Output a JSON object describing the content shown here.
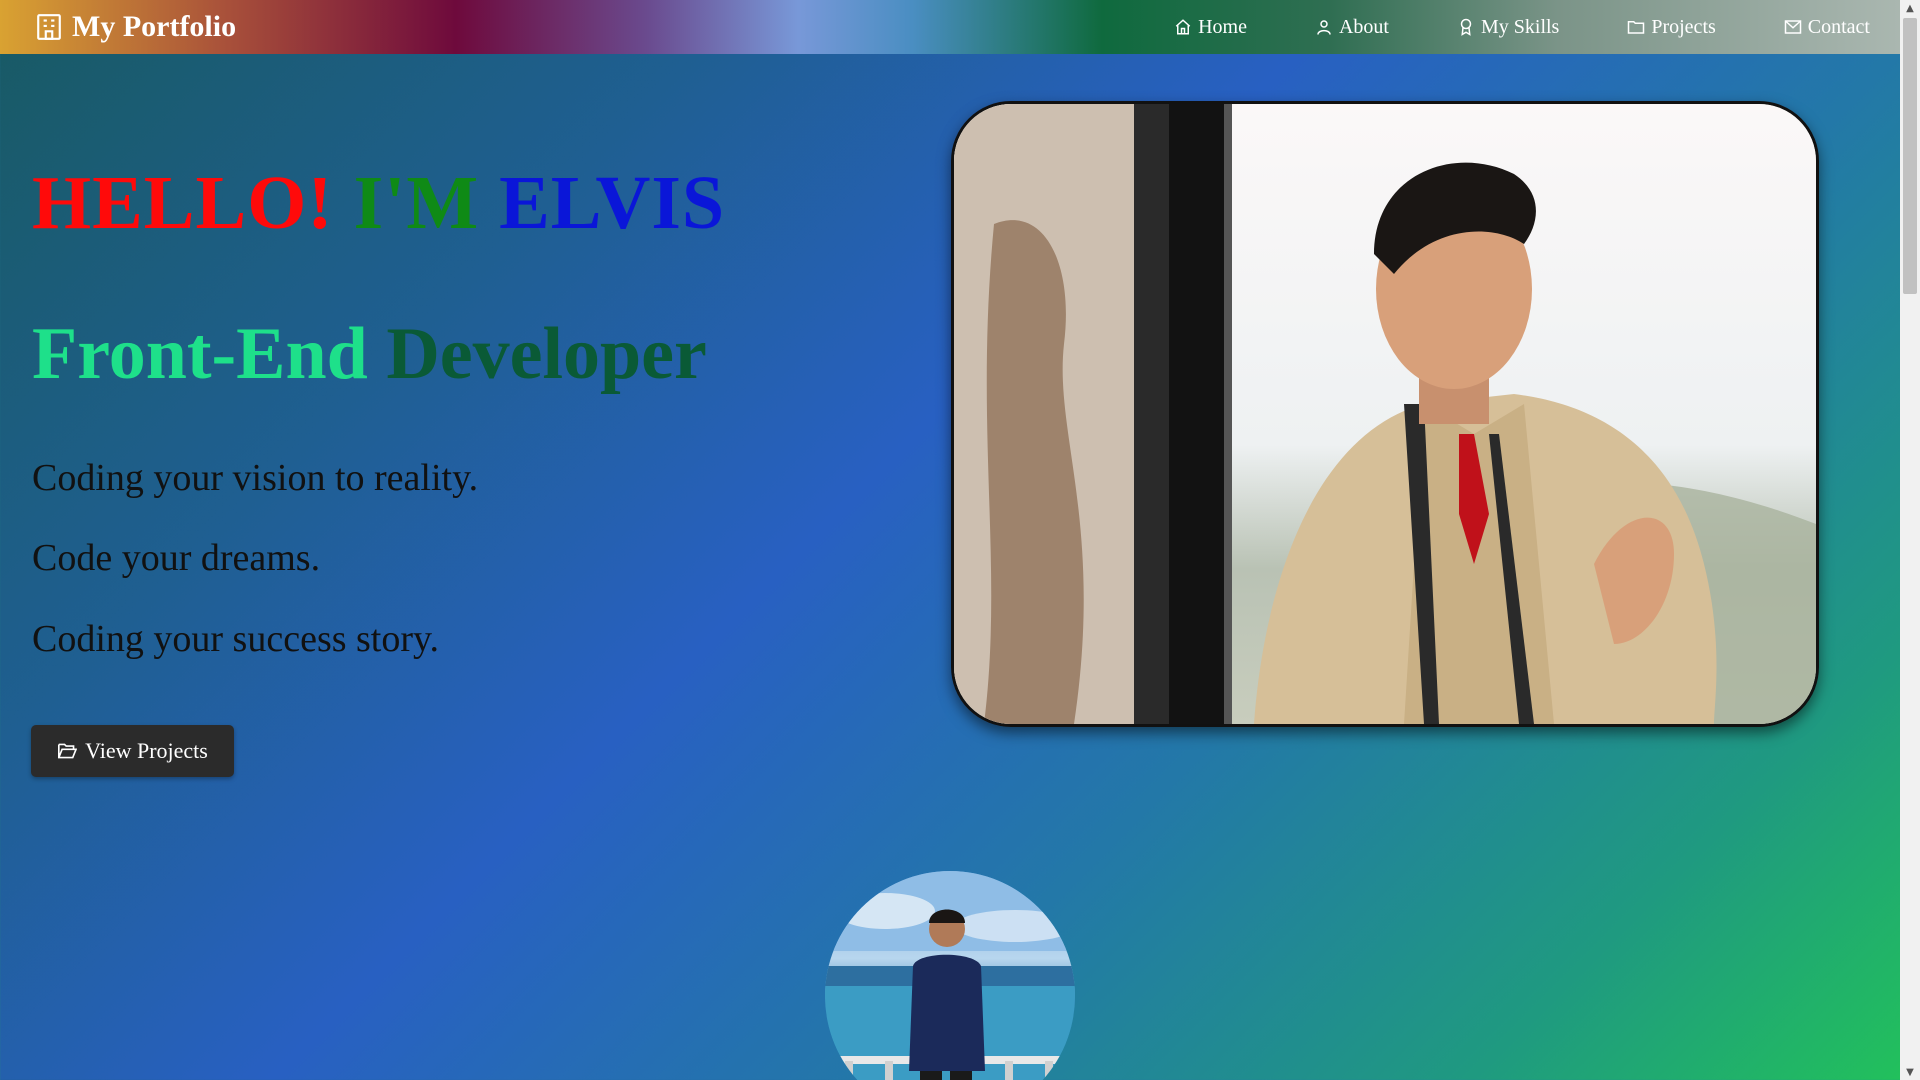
{
  "header": {
    "brand": "My Portfolio",
    "nav": [
      {
        "label": "Home",
        "icon": "home-icon"
      },
      {
        "label": "About",
        "icon": "user-icon"
      },
      {
        "label": "My Skills",
        "icon": "award-icon"
      },
      {
        "label": "Projects",
        "icon": "folder-icon"
      },
      {
        "label": "Contact",
        "icon": "mail-icon"
      }
    ]
  },
  "hero": {
    "greeting": [
      "HELLO!",
      "I'M",
      "ELVIS"
    ],
    "role": [
      "Front-End",
      "Developer"
    ],
    "taglines": [
      "Coding your vision to reality.",
      "Code your dreams.",
      "Coding your success story."
    ],
    "cta_label": "View Projects"
  },
  "colors": {
    "hello": "#ff0a0a",
    "im": "#0f8a16",
    "elvis": "#0a16d8",
    "front_end": "#1ee08a",
    "developer": "#0a5a36",
    "button": "#2b2b2b"
  }
}
